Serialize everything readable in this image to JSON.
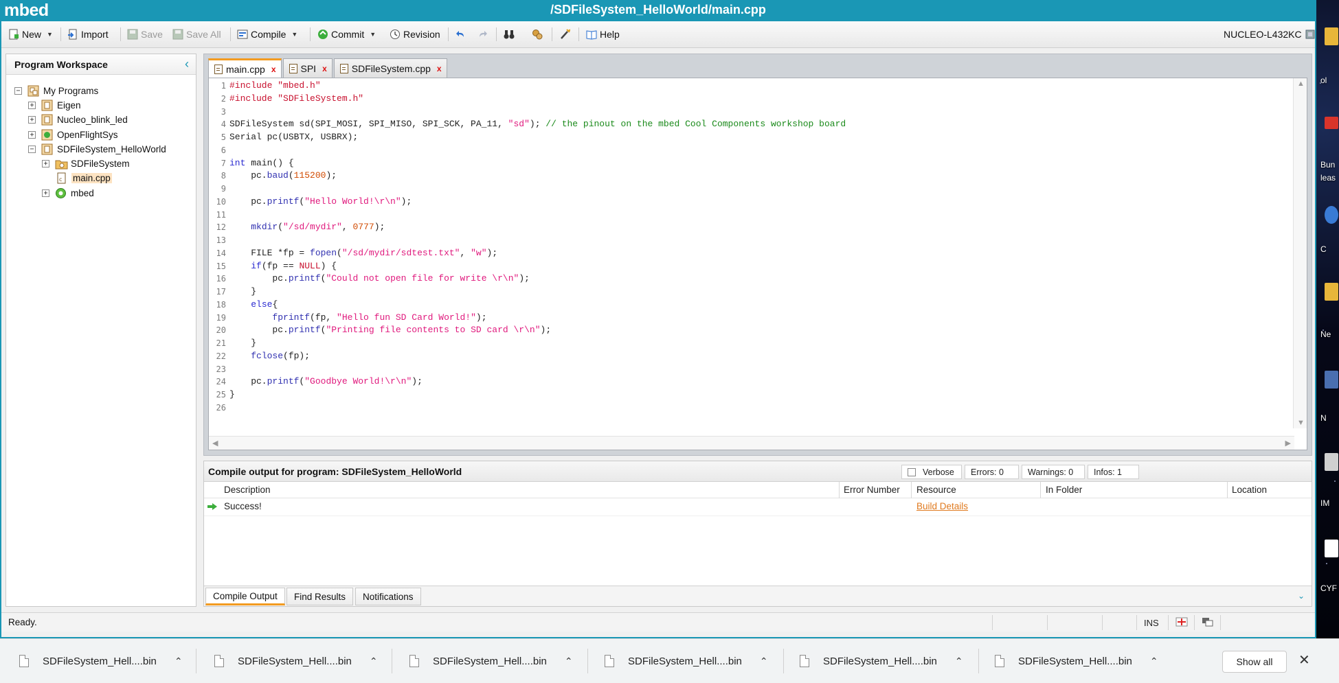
{
  "app": {
    "brand": "mbed",
    "window_title": "/SDFileSystem_HelloWorld/main.cpp"
  },
  "toolbar": {
    "new": "New",
    "import": "Import",
    "save": "Save",
    "save_all": "Save All",
    "compile": "Compile",
    "commit": "Commit",
    "revision": "Revision",
    "help": "Help",
    "target": "NUCLEO-L432KC"
  },
  "workspace": {
    "title": "Program Workspace",
    "root": "My Programs",
    "items": [
      {
        "label": "Eigen",
        "toggle": "+"
      },
      {
        "label": "Nucleo_blink_led",
        "toggle": "+"
      },
      {
        "label": "OpenFlightSys",
        "toggle": "+"
      },
      {
        "label": "SDFileSystem_HelloWorld",
        "toggle": "−"
      },
      {
        "label": "SDFileSystem",
        "toggle": "+"
      },
      {
        "label": "main.cpp",
        "toggle": ""
      },
      {
        "label": "mbed",
        "toggle": "+"
      }
    ]
  },
  "editor": {
    "tabs": [
      {
        "label": "main.cpp",
        "active": true
      },
      {
        "label": "SPI",
        "active": false
      },
      {
        "label": "SDFileSystem.cpp",
        "active": false
      }
    ],
    "close_glyph": "x",
    "line_numbers": [
      "1",
      "2",
      "3",
      "4",
      "5",
      "6",
      "7",
      "8",
      "9",
      "10",
      "11",
      "12",
      "13",
      "14",
      "15",
      "16",
      "17",
      "18",
      "19",
      "20",
      "21",
      "22",
      "23",
      "24",
      "25",
      "26"
    ],
    "lines": [
      "#include \"mbed.h\"",
      "#include \"SDFileSystem.h\"",
      "",
      "SDFileSystem sd(SPI_MOSI, SPI_MISO, SPI_SCK, PA_11, \"sd\"); // the pinout on the mbed Cool Components workshop board",
      "Serial pc(USBTX, USBRX);",
      "",
      "int main() {",
      "    pc.baud(115200);",
      "",
      "    pc.printf(\"Hello World!\\r\\n\");",
      "",
      "    mkdir(\"/sd/mydir\", 0777);",
      "",
      "    FILE *fp = fopen(\"/sd/mydir/sdtest.txt\", \"w\");",
      "    if(fp == NULL) {",
      "        pc.printf(\"Could not open file for write \\r\\n\");",
      "    }",
      "    else{",
      "        fprintf(fp, \"Hello fun SD Card World!\");",
      "        pc.printf(\"Printing file contents to SD card \\r\\n\");",
      "    }",
      "    fclose(fp);",
      "",
      "    pc.printf(\"Goodbye World!\\r\\n\");",
      "}",
      ""
    ]
  },
  "output": {
    "title": "Compile output for program: SDFileSystem_HelloWorld",
    "verbose": "Verbose",
    "errors": "Errors: 0",
    "warnings": "Warnings: 0",
    "infos": "Infos: 1",
    "columns": [
      "Description",
      "Error Number",
      "Resource",
      "In Folder",
      "Location"
    ],
    "rows": [
      {
        "description": "Success!",
        "error_number": "",
        "resource": "Build Details",
        "in_folder": "",
        "location": ""
      }
    ],
    "tabs": [
      "Compile Output",
      "Find Results",
      "Notifications"
    ]
  },
  "status": {
    "text": "Ready.",
    "mode": "INS"
  },
  "downloads": {
    "items": [
      "SDFileSystem_Hell....bin",
      "SDFileSystem_Hell....bin",
      "SDFileSystem_Hell....bin",
      "SDFileSystem_Hell....bin",
      "SDFileSystem_Hell....bin",
      "SDFileSystem_Hell....bin"
    ],
    "show_all": "Show all"
  },
  "desktop": {
    "labels": [
      "ol",
      "Bun",
      "leas",
      "C",
      "Ne",
      "N",
      "IM",
      "CYF"
    ]
  },
  "colors": {
    "accent": "#1a97b5",
    "tab_highlight": "#f39b21",
    "link": "#e07a1f"
  }
}
